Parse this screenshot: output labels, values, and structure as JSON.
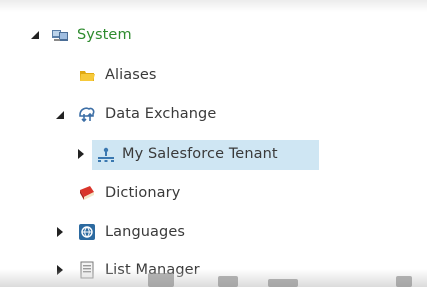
{
  "tree": {
    "items": [
      {
        "label": "System",
        "icon": "system-icon",
        "expander": "expanded"
      },
      {
        "label": "Aliases",
        "icon": "folder-icon",
        "expander": "none"
      },
      {
        "label": "Data Exchange",
        "icon": "data-exchange-icon",
        "expander": "expanded"
      },
      {
        "label": "My Salesforce Tenant",
        "icon": "salesforce-tenant-icon",
        "expander": "collapsed",
        "selected": true
      },
      {
        "label": "Dictionary",
        "icon": "dictionary-icon",
        "expander": "none"
      },
      {
        "label": "Languages",
        "icon": "languages-icon",
        "expander": "collapsed"
      },
      {
        "label": "List Manager",
        "icon": "list-manager-icon",
        "expander": "collapsed"
      }
    ]
  },
  "colors": {
    "root_label": "#2e8b2e",
    "label": "#3a3a3a",
    "selection": "#cfe6f3"
  }
}
